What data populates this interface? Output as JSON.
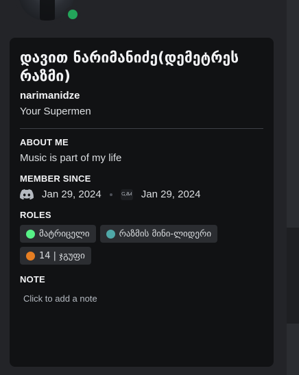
{
  "profile": {
    "display_name": "დავით ნარიმანიძე(დემეტრეს რაზმი)",
    "username": "narimanidze",
    "custom_status": "Your Supermen",
    "status": "online"
  },
  "about_me": {
    "title": "ABOUT ME",
    "text": "Music is part of my life"
  },
  "member_since": {
    "title": "MEMBER SINCE",
    "discord_date": "Jan 29, 2024",
    "server_date": "Jan 29, 2024",
    "discord_icon": "discord-logo-icon",
    "server_icon": "server-icon",
    "server_icon_text": "ᏩᏰᏗ"
  },
  "roles": {
    "title": "ROLES",
    "items": [
      {
        "label": "მატრიცელი",
        "color": "#57f287"
      },
      {
        "label": "რაზმის მინი-ლიდერი",
        "color": "#4fa8a8"
      },
      {
        "label": "14 | ჯგუფი",
        "color": "#e67e22"
      }
    ]
  },
  "note": {
    "title": "NOTE",
    "placeholder": "Click to add a note"
  },
  "colors": {
    "background": "#232428",
    "card": "#111214",
    "online": "#23a55a"
  }
}
